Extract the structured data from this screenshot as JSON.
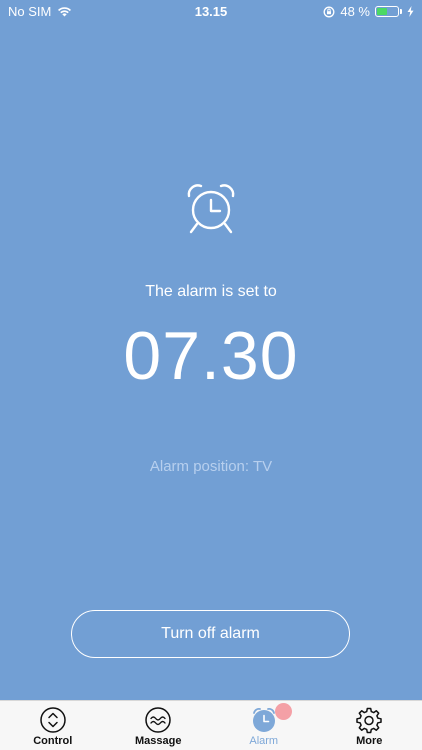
{
  "status_bar": {
    "carrier": "No SIM",
    "time": "13.15",
    "battery_percent": "48 %",
    "battery_level": 0.48
  },
  "alarm": {
    "set_label": "The alarm is set to",
    "time": "07.30",
    "position_label": "Alarm position: TV",
    "turn_off_label": "Turn off alarm"
  },
  "tabs": [
    {
      "label": "Control",
      "icon": "chevron-up-down-icon"
    },
    {
      "label": "Massage",
      "icon": "wave-icon"
    },
    {
      "label": "Alarm",
      "icon": "alarm-clock-icon",
      "active": true
    },
    {
      "label": "More",
      "icon": "gear-icon"
    }
  ],
  "colors": {
    "background": "#729fd4",
    "active_tab": "#7ea8d8",
    "badge": "#f4a0a6",
    "battery_fill": "#4cd964"
  }
}
